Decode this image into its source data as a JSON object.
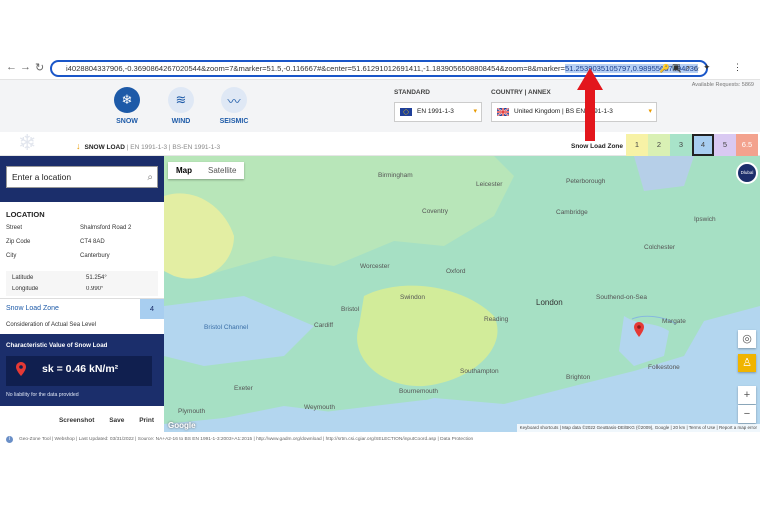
{
  "browser": {
    "url_prefix": "i4028804337906,-0.3690864267020544&zoom=7&marker=51.5,-0.116667#&center=51.61291012691411,-1.1839056508808454&zoom=8&marker=",
    "url_highlight": "51.2539035105797,0.98955637494036",
    "back_icon": "back-arrow-icon",
    "forward_icon": "forward-arrow-icon",
    "reload_icon": "reload-icon"
  },
  "available_requests": "Available Requests: 5869",
  "header": {
    "tabs": [
      {
        "label": "SNOW",
        "icon": "snowflake-icon",
        "color": "#1d5aa8"
      },
      {
        "label": "WIND",
        "icon": "wind-icon",
        "color": "#dfe8f5"
      },
      {
        "label": "SEISMIC",
        "icon": "seismic-icon",
        "color": "#dfe8f5"
      }
    ],
    "standard_label": "STANDARD",
    "standard_value": "EN 1991-1-3",
    "country_label": "COUNTRY | ANNEX",
    "country_value": "United Kingdom | BS EN 1991-1-3"
  },
  "breadcrumb": {
    "active": "SNOW LOAD",
    "rest": "| EN 1991-1-3 | BS-EN 1991-1-3"
  },
  "snow_load_zone_label": "Snow Load Zone",
  "zones": [
    {
      "label": "1",
      "color": "#f7f2a6"
    },
    {
      "label": "2",
      "color": "#d9f0b4"
    },
    {
      "label": "3",
      "color": "#a8e3c9"
    },
    {
      "label": "4",
      "color": "#a8cef0"
    },
    {
      "label": "5",
      "color": "#d9c9f2"
    },
    {
      "label": "6.5",
      "color": "#f3a28e"
    }
  ],
  "sidebar": {
    "search_placeholder": "Enter a location",
    "location_title": "LOCATION",
    "fields": [
      {
        "label": "Street",
        "value": "Shalmsford Road 2"
      },
      {
        "label": "Zip Code",
        "value": "CT4 8AD"
      },
      {
        "label": "City",
        "value": "Canterbury"
      }
    ],
    "latitude_label": "Latitude",
    "latitude_value": "51.254°",
    "longitude_label": "Longitude",
    "longitude_value": "0.990°",
    "snow_zone_title": "Snow Load Zone",
    "snow_zone_value": "4",
    "consider_text": "Consideration of Actual Sea Level",
    "char_title": "Characteristic Value of Snow Load",
    "sk_value": "sk = 0.46 kN/m²",
    "no_liability": "No liability for the data provided",
    "actions": [
      "Screenshot",
      "Save",
      "Print"
    ]
  },
  "map": {
    "tabs": [
      "Map",
      "Satellite"
    ],
    "places": [
      {
        "name": "Birmingham"
      },
      {
        "name": "Coventry"
      },
      {
        "name": "Leicester"
      },
      {
        "name": "Peterborough"
      },
      {
        "name": "Cambridge"
      },
      {
        "name": "Worcester"
      },
      {
        "name": "Oxford"
      },
      {
        "name": "Swindon"
      },
      {
        "name": "Cardiff"
      },
      {
        "name": "Bristol"
      },
      {
        "name": "Reading"
      },
      {
        "name": "London"
      },
      {
        "name": "Southend-on-Sea"
      },
      {
        "name": "Margate"
      },
      {
        "name": "Southampton"
      },
      {
        "name": "Brighton"
      },
      {
        "name": "Bournemouth"
      },
      {
        "name": "Exeter"
      },
      {
        "name": "Folkestone"
      },
      {
        "name": "Colchester"
      },
      {
        "name": "Ipswich"
      },
      {
        "name": "Bristol Channel"
      },
      {
        "name": "Weymouth"
      },
      {
        "name": "Plymouth"
      }
    ],
    "badge": "Dlubal",
    "attribution": "Keyboard shortcuts | Map data ©2022 GeoBasis-DE/BKG (©2009), Google | 20 km | Terms of Use | Report a map error",
    "google_logo": "Google",
    "zoom_in": "+",
    "zoom_out": "−"
  },
  "footer": "Geo-Zone Tool | Webshop | Last Updated: 03/31/2022 | Source: NA+A2-16 to BS EN 1991-1-3:2003+A1:2015 | http://www.gadm.org/download | http://srtm.csi.cgiar.org/SELECTION/inputCoord.asp | Data Protection"
}
